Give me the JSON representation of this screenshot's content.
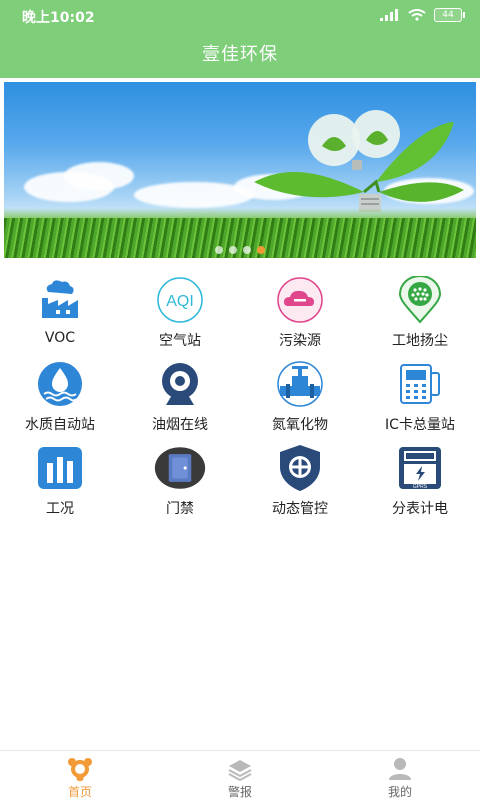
{
  "status": {
    "time": "晚上10:02",
    "battery": "44"
  },
  "header": {
    "title": "壹佳环保"
  },
  "grid": [
    {
      "label": "VOC",
      "icon": "factory-icon"
    },
    {
      "label": "空气站",
      "icon": "aqi-icon"
    },
    {
      "label": "污染源",
      "icon": "cloud-minus-icon"
    },
    {
      "label": "工地扬尘",
      "icon": "dust-pin-icon"
    },
    {
      "label": "水质自动站",
      "icon": "water-drop-icon"
    },
    {
      "label": "油烟在线",
      "icon": "webcam-icon"
    },
    {
      "label": "氮氧化物",
      "icon": "pipe-valve-icon"
    },
    {
      "label": "IC卡总量站",
      "icon": "card-reader-icon"
    },
    {
      "label": "工况",
      "icon": "bar-chart-icon"
    },
    {
      "label": "门禁",
      "icon": "door-icon"
    },
    {
      "label": "动态管控",
      "icon": "shield-cross-icon"
    },
    {
      "label": "分表计电",
      "icon": "electric-meter-icon"
    }
  ],
  "banner": {
    "icon_text": "AQI",
    "meter_text": "GPRS"
  },
  "tabs": [
    {
      "label": "首页",
      "icon": "home-icon",
      "active": true
    },
    {
      "label": "警报",
      "icon": "layers-icon",
      "active": false
    },
    {
      "label": "我的",
      "icon": "person-icon",
      "active": false
    }
  ],
  "colors": {
    "header": "#7ece7a",
    "active_tab": "#f19a38"
  }
}
